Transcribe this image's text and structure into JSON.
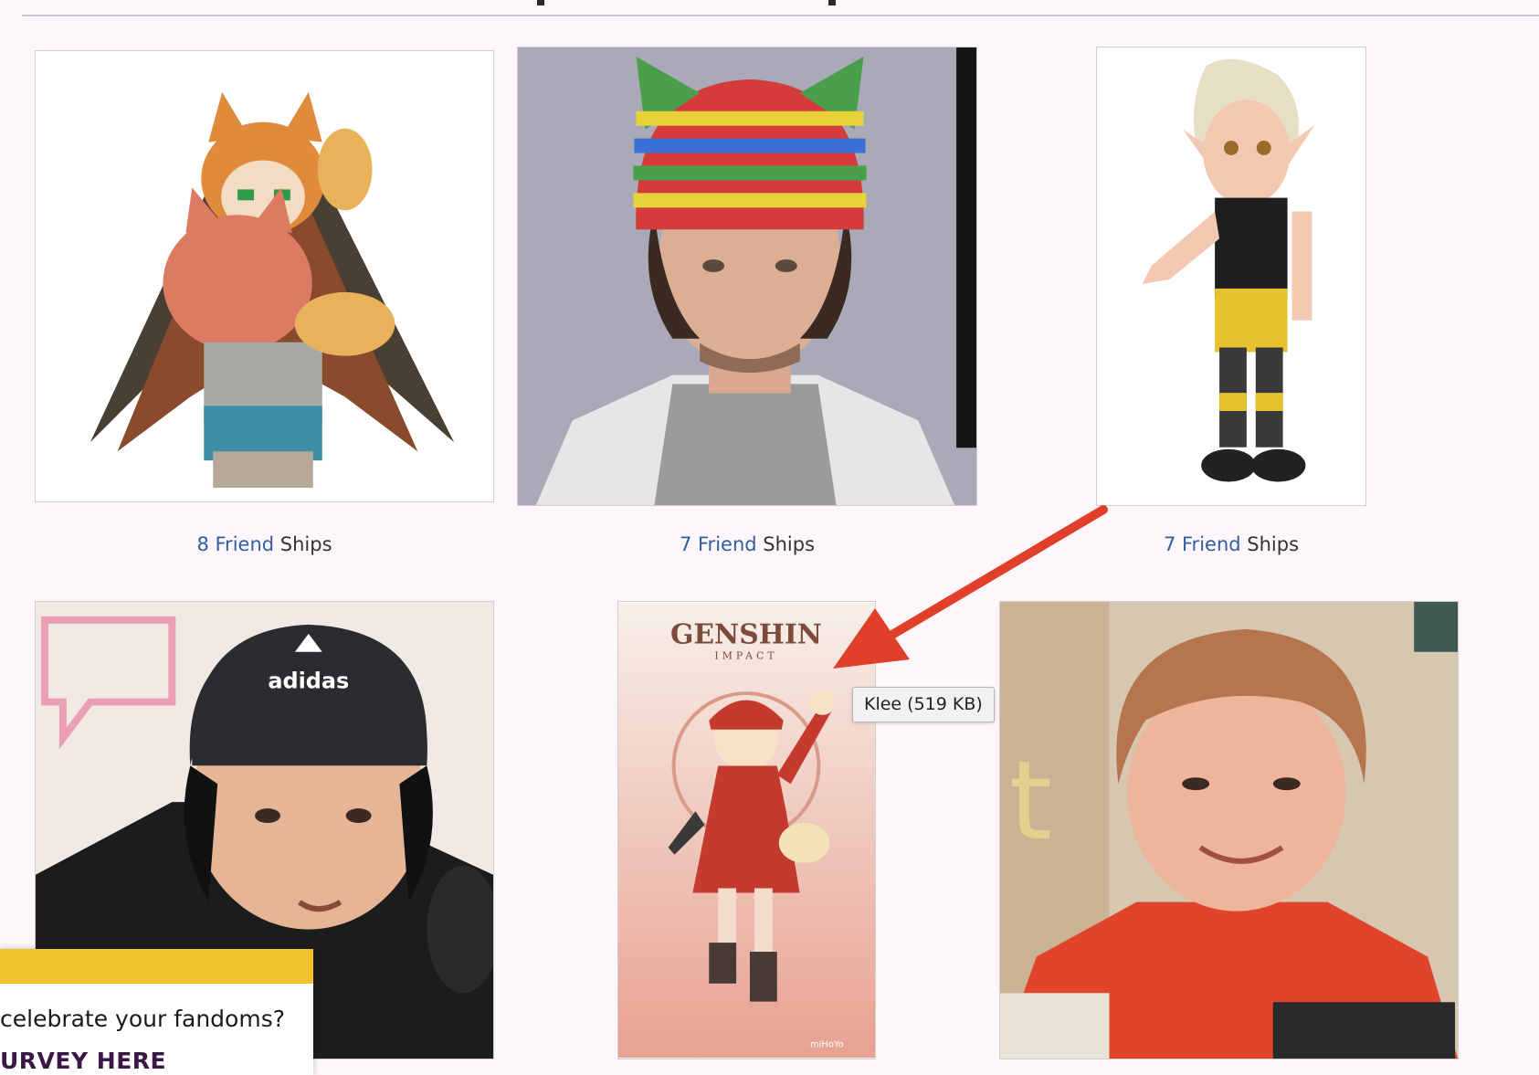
{
  "gallery": {
    "items": [
      {
        "name": "cat-hood-anime-character"
      },
      {
        "name": "striped-beanie-person"
      },
      {
        "name": "elf-cartoon-character"
      },
      {
        "name": "adidas-beanie-person"
      },
      {
        "name": "klee-genshin-poster",
        "poster_brand": "GENSHIN",
        "poster_sub": "IMPACT",
        "poster_mark": "miHoYo"
      },
      {
        "name": "red-hoodie-person"
      }
    ],
    "captions": [
      {
        "count_link": "8 Friend",
        "suffix": " Ships"
      },
      {
        "count_link": "7 Friend",
        "suffix": " Ships"
      },
      {
        "count_link": "7 Friend",
        "suffix": " Ships"
      }
    ],
    "overlay_text": {
      "adidas": "adidas"
    }
  },
  "tooltip": {
    "text": "Klee (519 KB)"
  },
  "survey_popup": {
    "text": "celebrate your fandoms?",
    "link": "URVEY HERE",
    "accent_color": "#f2c12e"
  },
  "annotation": {
    "arrow_color": "#e0402a",
    "icon": "arrow-icon"
  }
}
